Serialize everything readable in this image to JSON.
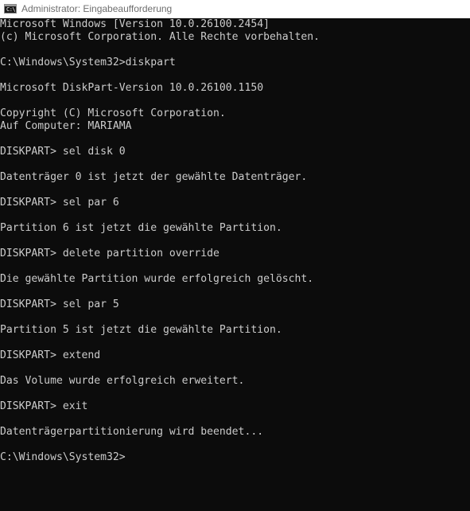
{
  "window": {
    "title": "Administrator: Eingabeaufforderung",
    "icon": "cmd-icon",
    "icon_glyph": "C:\\"
  },
  "console": {
    "background": "#0c0c0c",
    "foreground": "#cccccc",
    "lines": [
      "Microsoft Windows [Version 10.0.26100.2454]",
      "(c) Microsoft Corporation. Alle Rechte vorbehalten.",
      "",
      "C:\\Windows\\System32>diskpart",
      "",
      "Microsoft DiskPart-Version 10.0.26100.1150",
      "",
      "Copyright (C) Microsoft Corporation.",
      "Auf Computer: MARIAMA",
      "",
      "DISKPART> sel disk 0",
      "",
      "Datenträger 0 ist jetzt der gewählte Datenträger.",
      "",
      "DISKPART> sel par 6",
      "",
      "Partition 6 ist jetzt die gewählte Partition.",
      "",
      "DISKPART> delete partition override",
      "",
      "Die gewählte Partition wurde erfolgreich gelöscht.",
      "",
      "DISKPART> sel par 5",
      "",
      "Partition 5 ist jetzt die gewählte Partition.",
      "",
      "DISKPART> extend",
      "",
      "Das Volume wurde erfolgreich erweitert.",
      "",
      "DISKPART> exit",
      "",
      "Datenträgerpartitionierung wird beendet...",
      "",
      "C:\\Windows\\System32>"
    ]
  }
}
